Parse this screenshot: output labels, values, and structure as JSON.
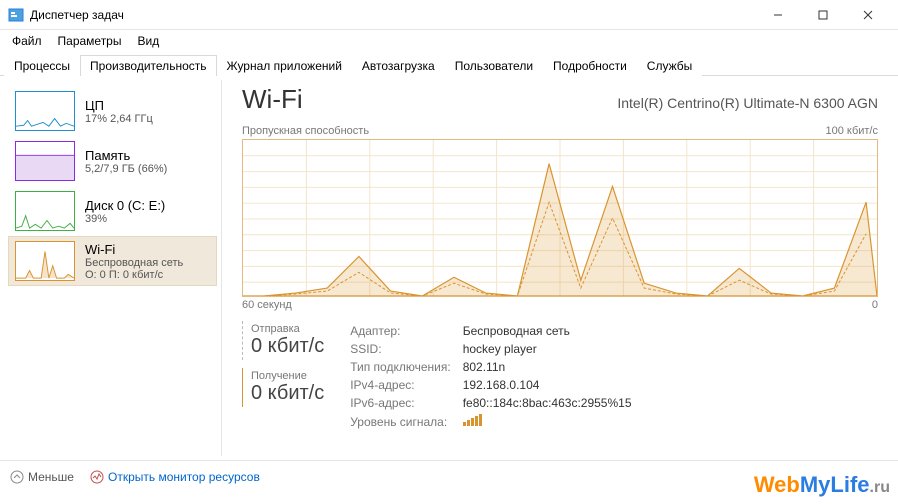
{
  "window": {
    "title": "Диспетчер задач",
    "minimize": "—",
    "maximize": "☐",
    "close": "✕"
  },
  "menu": [
    "Файл",
    "Параметры",
    "Вид"
  ],
  "tabs": [
    "Процессы",
    "Производительность",
    "Журнал приложений",
    "Автозагрузка",
    "Пользователи",
    "Подробности",
    "Службы"
  ],
  "active_tab": 1,
  "sidebar": [
    {
      "title": "ЦП",
      "sub": "17% 2,64 ГГц",
      "color": "#1e90cc"
    },
    {
      "title": "Память",
      "sub": "5,2/7,9 ГБ (66%)",
      "color": "#8a2be2"
    },
    {
      "title": "Диск 0 (C: E:)",
      "sub": "39%",
      "color": "#3cb043"
    },
    {
      "title": "Wi-Fi",
      "sub": "Беспроводная сеть",
      "sub2": "О: 0 П: 0 кбит/с",
      "color": "#d9942f"
    }
  ],
  "sidebar_selected": 3,
  "main": {
    "title": "Wi-Fi",
    "adapter": "Intel(R) Centrino(R) Ultimate-N 6300 AGN",
    "chart_label": "Пропускная способность",
    "chart_max": "100 кбит/с",
    "chart_xmin": "60 секунд",
    "chart_xmax": "0",
    "send_label": "Отправка",
    "send_value": "0 кбит/с",
    "recv_label": "Получение",
    "recv_value": "0 кбит/с",
    "details": {
      "adapter_k": "Адаптер:",
      "adapter_v": "Беспроводная сеть",
      "ssid_k": "SSID:",
      "ssid_v": "hockey player",
      "conn_k": "Тип подключения:",
      "conn_v": "802.11n",
      "ipv4_k": "IPv4-адрес:",
      "ipv4_v": "192.168.0.104",
      "ipv6_k": "IPv6-адрес:",
      "ipv6_v": "fe80::184c:8bac:463c:2955%15",
      "signal_k": "Уровень сигнала:"
    }
  },
  "bottom": {
    "fewer": "Меньше",
    "monitor": "Открыть монитор ресурсов"
  },
  "chart_data": {
    "type": "line",
    "title": "Пропускная способность",
    "xlabel": "секунды",
    "ylabel": "кбит/с",
    "x_range": [
      60,
      0
    ],
    "ylim": [
      0,
      100
    ],
    "series": [
      {
        "name": "Отправка",
        "x": [
          58,
          55,
          52,
          49,
          46,
          43,
          40,
          37,
          34,
          31,
          28,
          25,
          22,
          19,
          16,
          13,
          10,
          7,
          4,
          1
        ],
        "values": [
          0,
          2,
          5,
          25,
          3,
          0,
          12,
          2,
          0,
          85,
          10,
          70,
          8,
          2,
          0,
          18,
          2,
          0,
          5,
          60
        ]
      },
      {
        "name": "Получение",
        "x": [
          58,
          55,
          52,
          49,
          46,
          43,
          40,
          37,
          34,
          31,
          28,
          25,
          22,
          19,
          16,
          13,
          10,
          7,
          4,
          1
        ],
        "values": [
          0,
          1,
          3,
          15,
          2,
          0,
          8,
          1,
          0,
          60,
          5,
          50,
          5,
          1,
          0,
          10,
          1,
          0,
          3,
          40
        ]
      }
    ]
  },
  "watermark": {
    "a": "Web",
    "b": "MyLife",
    "c": ".ru"
  }
}
